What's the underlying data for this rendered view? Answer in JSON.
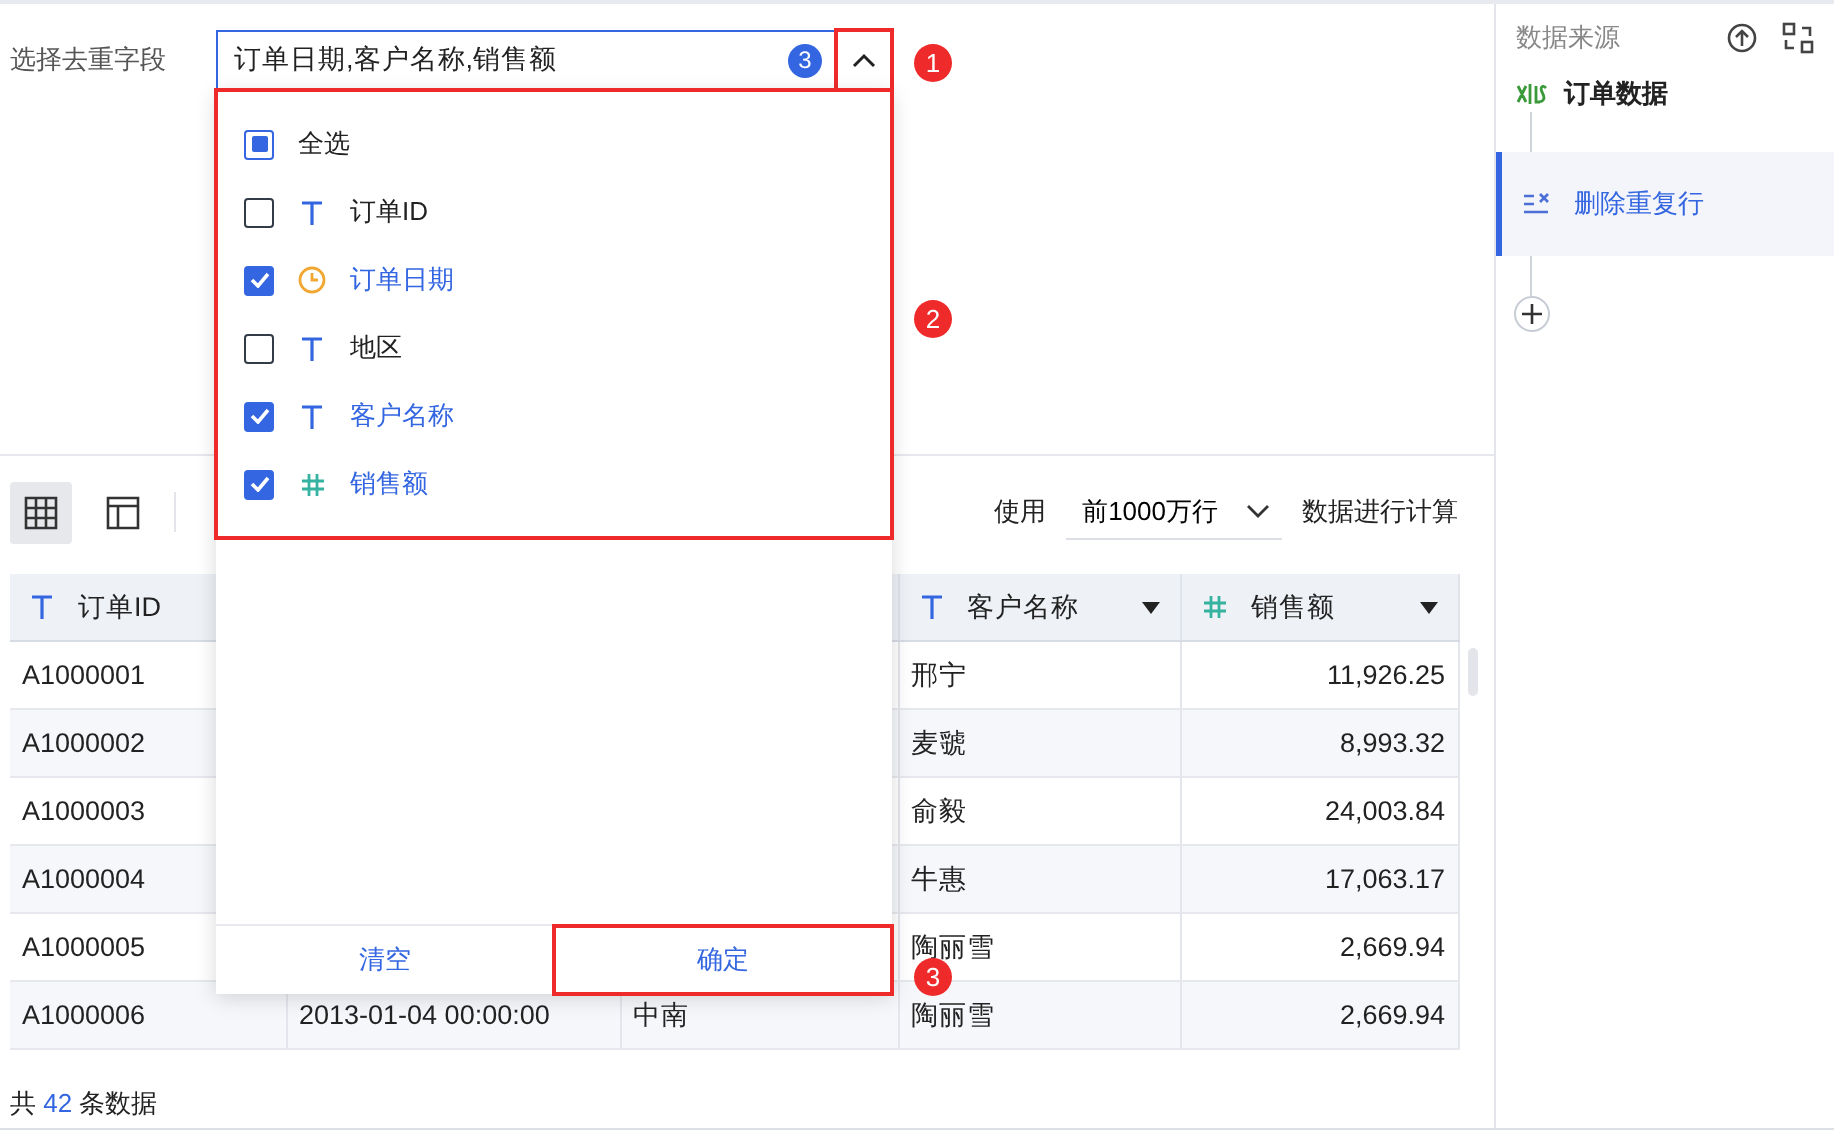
{
  "field_picker": {
    "label": "选择去重字段",
    "value": "订单日期,客户名称,销售额",
    "count": "3",
    "expanded": true,
    "options": [
      {
        "label": "全选",
        "kind": "all",
        "checked": false,
        "indeterminate": true
      },
      {
        "label": "订单ID",
        "kind": "text",
        "checked": false
      },
      {
        "label": "订单日期",
        "kind": "date",
        "checked": true
      },
      {
        "label": "地区",
        "kind": "text",
        "checked": false
      },
      {
        "label": "客户名称",
        "kind": "text",
        "checked": true
      },
      {
        "label": "销售额",
        "kind": "number",
        "checked": true
      }
    ],
    "clear_button": "清空",
    "confirm_button": "确定"
  },
  "toolbar": {
    "views": [
      {
        "kind": "grid",
        "selected": true
      },
      {
        "kind": "layout",
        "selected": false
      }
    ],
    "use_label": "使用",
    "row_limit": "前1000万行",
    "suffix": "数据进行计算"
  },
  "table": {
    "columns": [
      {
        "label": "订单ID",
        "kind": "text"
      },
      null,
      null,
      {
        "label": "客户名称",
        "kind": "text"
      },
      {
        "label": "销售额",
        "kind": "number"
      }
    ],
    "rows": [
      [
        "A1000001",
        null,
        null,
        "邢宁",
        "11,926.25"
      ],
      [
        "A1000002",
        null,
        null,
        "麦虢",
        "8,993.32"
      ],
      [
        "A1000003",
        null,
        null,
        "俞毅",
        "24,003.84"
      ],
      [
        "A1000004",
        null,
        null,
        "牛惠",
        "17,063.17"
      ],
      [
        "A1000005",
        null,
        null,
        "陶丽雪",
        "2,669.94"
      ],
      [
        "A1000006",
        "2013-01-04 00:00:00",
        "中南",
        "陶丽雪",
        "2,669.94"
      ]
    ]
  },
  "footer": {
    "prefix": "共",
    "count": "42",
    "suffix": "条数据"
  },
  "sidebar": {
    "title": "数据来源",
    "source": "订单数据",
    "steps": [
      {
        "label": "删除重复行",
        "selected": true
      }
    ]
  },
  "annotations": [
    {
      "label": "1",
      "kind": "toggle"
    },
    {
      "label": "2",
      "kind": "list"
    },
    {
      "label": "3",
      "kind": "confirm"
    }
  ]
}
